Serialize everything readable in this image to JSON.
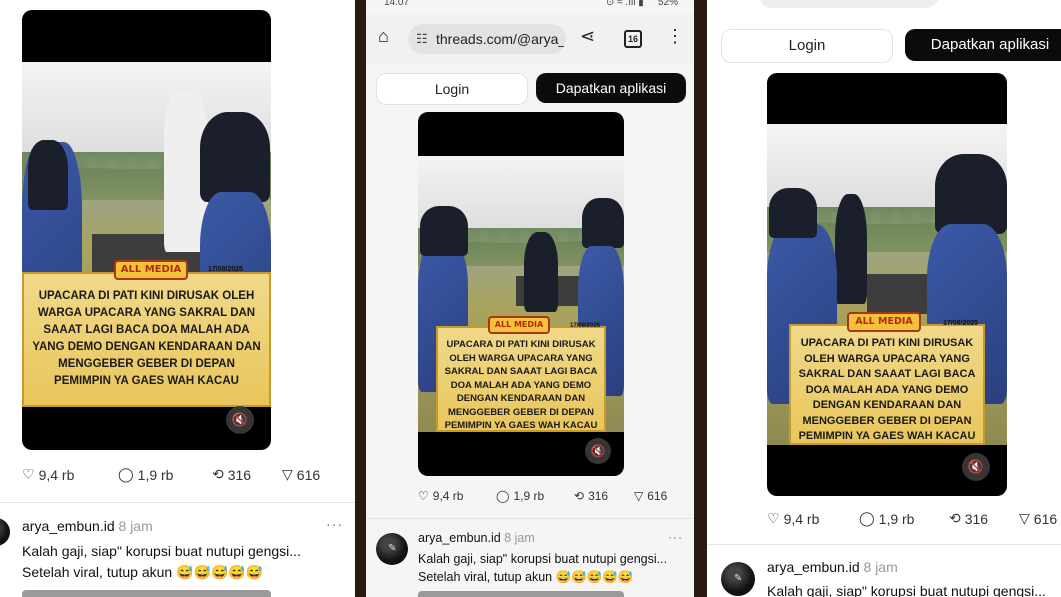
{
  "browser": {
    "time": "14.07",
    "battery": "52%",
    "url": "threads.com/@arya_",
    "tab_count": "16"
  },
  "header": {
    "login_label": "Login",
    "get_app_label": "Dapatkan aplikasi"
  },
  "video": {
    "banner_text": "ALL MEDIA",
    "date": "17/08/2025",
    "caption": "UPACARA DI PATI KINI DIRUSAK OLEH WARGA UPACARA YANG SAKRAL DAN SAAAT LAGI BACA DOA MALAH ADA YANG DEMO DENGAN KENDARAAN DAN MENGGEBER GEBER DI DEPAN PEMIMPIN YA GAES WAH KACAU",
    "mute_icon": "muted-speaker-icon"
  },
  "stats": {
    "likes": "9,4 rb",
    "replies": "1,9 rb",
    "reposts": "316",
    "shares": "616"
  },
  "reply": {
    "username": "arya_embun.id",
    "time": "8 jam",
    "more": "···",
    "line1": "Kalah gaji, siap\" korupsi buat nutupi gengsi...",
    "line2": "Setelah viral, tutup akun 😅😅😅😅😅"
  },
  "colors": {
    "background": "#2a1a12",
    "button_dark": "#0b0b0b",
    "caption_gold": "#e9c65c"
  }
}
